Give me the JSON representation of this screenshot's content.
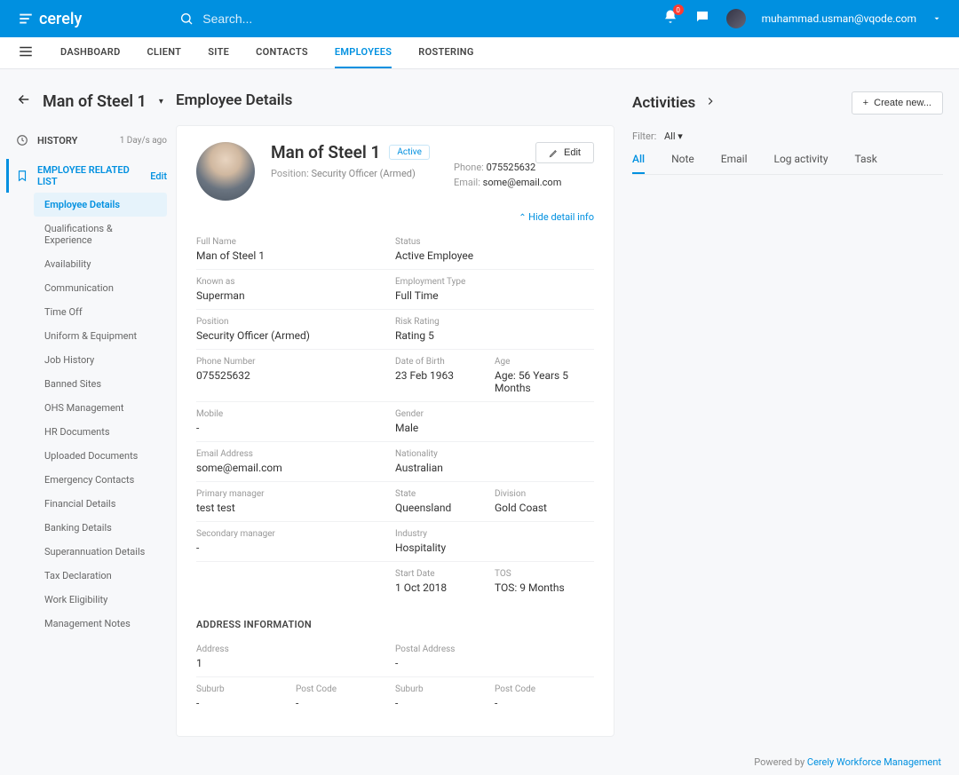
{
  "brand": "cerely",
  "search_placeholder": "Search...",
  "notif_count": "0",
  "user_email": "muhammad.usman@vqode.com",
  "nav": [
    "DASHBOARD",
    "CLIENT",
    "SITE",
    "CONTACTS",
    "EMPLOYEES",
    "ROSTERING"
  ],
  "page_title": "Man of Steel 1",
  "sidebar": {
    "history": {
      "label": "HISTORY",
      "meta": "1 Day/s ago"
    },
    "related": {
      "label": "EMPLOYEE RELATED LIST",
      "edit": "Edit"
    },
    "items": [
      "Employee Details",
      "Qualifications & Experience",
      "Availability",
      "Communication",
      "Time Off",
      "Uniform & Equipment",
      "Job History",
      "Banned Sites",
      "OHS Management",
      "HR Documents",
      "Uploaded Documents",
      "Emergency Contacts",
      "Financial Details",
      "Banking Details",
      "Superannuation Details",
      "Tax Declaration",
      "Work Eligibility",
      "Management Notes"
    ]
  },
  "main": {
    "heading": "Employee Details",
    "edit_btn": "Edit",
    "name": "Man of Steel 1",
    "status_badge": "Active",
    "position_lbl": "Position:",
    "position_val": "Security Officer (Armed)",
    "phone_lbl": "Phone:",
    "phone_val": "075525632",
    "email_lbl": "Email:",
    "email_val": "some@email.com",
    "hide_link": "Hide detail info",
    "fields": {
      "full_name": {
        "lbl": "Full Name",
        "val": "Man of Steel 1"
      },
      "status": {
        "lbl": "Status",
        "val": "Active Employee"
      },
      "known_as": {
        "lbl": "Known as",
        "val": "Superman"
      },
      "emp_type": {
        "lbl": "Employment Type",
        "val": "Full Time"
      },
      "position": {
        "lbl": "Position",
        "val": "Security Officer (Armed)"
      },
      "risk": {
        "lbl": "Risk Rating",
        "val": "Rating 5"
      },
      "phone": {
        "lbl": "Phone Number",
        "val": "075525632"
      },
      "dob": {
        "lbl": "Date of Birth",
        "val": "23 Feb 1963"
      },
      "age": {
        "lbl": "Age",
        "val": "Age: 56 Years 5 Months"
      },
      "mobile": {
        "lbl": "Mobile",
        "val": "-"
      },
      "gender": {
        "lbl": "Gender",
        "val": "Male"
      },
      "email": {
        "lbl": "Email Address",
        "val": "some@email.com"
      },
      "nationality": {
        "lbl": "Nationality",
        "val": "Australian"
      },
      "pri_mgr": {
        "lbl": "Primary manager",
        "val": "test test"
      },
      "state": {
        "lbl": "State",
        "val": "Queensland"
      },
      "division": {
        "lbl": "Division",
        "val": "Gold Coast"
      },
      "sec_mgr": {
        "lbl": "Secondary manager",
        "val": "-"
      },
      "industry": {
        "lbl": "Industry",
        "val": "Hospitality"
      },
      "start": {
        "lbl": "Start Date",
        "val": "1 Oct 2018"
      },
      "tos": {
        "lbl": "TOS",
        "val": "TOS: 9 Months"
      }
    },
    "address_title": "ADDRESS INFORMATION",
    "address": {
      "addr": {
        "lbl": "Address",
        "val": "1"
      },
      "postal": {
        "lbl": "Postal Address",
        "val": "-"
      },
      "suburb1": {
        "lbl": "Suburb",
        "val": "-"
      },
      "postcode1": {
        "lbl": "Post Code",
        "val": "-"
      },
      "suburb2": {
        "lbl": "Suburb",
        "val": "-"
      },
      "postcode2": {
        "lbl": "Post Code",
        "val": "-"
      }
    }
  },
  "activities": {
    "title": "Activities",
    "create": "Create new...",
    "filter_lbl": "Filter:",
    "filter_val": "All",
    "tabs": [
      "All",
      "Note",
      "Email",
      "Log activity",
      "Task"
    ]
  },
  "footer": {
    "prefix": "Powered by ",
    "link": "Cerely Workforce Management"
  }
}
